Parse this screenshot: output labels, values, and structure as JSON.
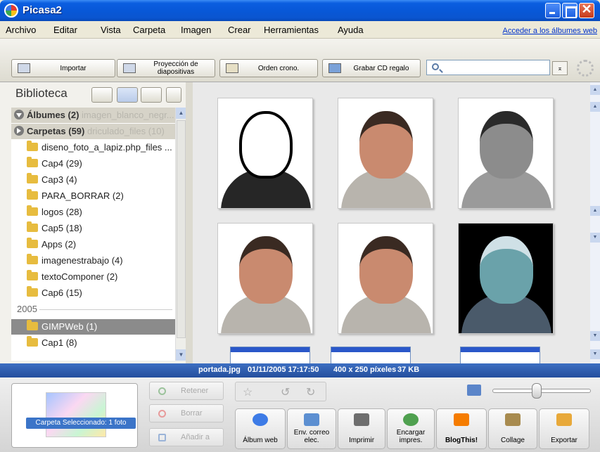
{
  "window": {
    "title": "Picasa2"
  },
  "menu": [
    "Archivo",
    "Editar",
    "Vista",
    "Carpeta",
    "Imagen",
    "Crear",
    "Herramientas",
    "Ayuda"
  ],
  "menu_link": "Acceder a los álbumes web",
  "toolbar": {
    "importar": "Importar",
    "proyeccion": "Proyección de diapositivas",
    "orden": "Orden crono.",
    "grabar": "Grabar CD regalo",
    "search_value": ""
  },
  "library": {
    "title": "Biblioteca",
    "albumes": "Álbumes (2)",
    "albumes_ghost": "imagen_blanco_negr...",
    "carpetas": "Carpetas (59)",
    "carpetas_ghost": "driculado_files (10)",
    "folders": [
      "diseno_foto_a_lapiz.php_files ...",
      "Cap4 (29)",
      "Cap3 (4)",
      "PARA_BORRAR (2)",
      "logos (28)",
      "Cap5 (18)",
      "Apps (2)",
      "imagenestrabajo (4)",
      "textoComponer (2)",
      "Cap6 (15)"
    ],
    "year": "2005",
    "selected": "GIMPWeb (1)",
    "after": "Cap1 (8)"
  },
  "thumbnails": [
    {
      "style": "sketch"
    },
    {
      "style": "color"
    },
    {
      "style": "gray"
    },
    {
      "style": "color"
    },
    {
      "style": "color"
    },
    {
      "style": "negative"
    }
  ],
  "status": {
    "file": "portada.jpg",
    "date": "01/11/2005 17:17:50",
    "dims": "400 x 250 píxeles",
    "size": "37 KB"
  },
  "tray": {
    "badge": "Carpeta Seleccionado: 1 foto",
    "retener": "Retener",
    "borrar": "Borrar",
    "anadir": "Añadir a"
  },
  "actions": [
    {
      "label": "Álbum web",
      "color": "#3d7be6"
    },
    {
      "label": "Env. correo elec.",
      "color": "#5c8fd1"
    },
    {
      "label": "Imprimir",
      "color": "#6e6e6e"
    },
    {
      "label": "Encargar impres.",
      "color": "#4fa04f"
    },
    {
      "label": "BlogThis!",
      "color": "#f57c00"
    },
    {
      "label": "Collage",
      "color": "#a88b4f"
    },
    {
      "label": "Exportar",
      "color": "#e8a93a"
    }
  ]
}
